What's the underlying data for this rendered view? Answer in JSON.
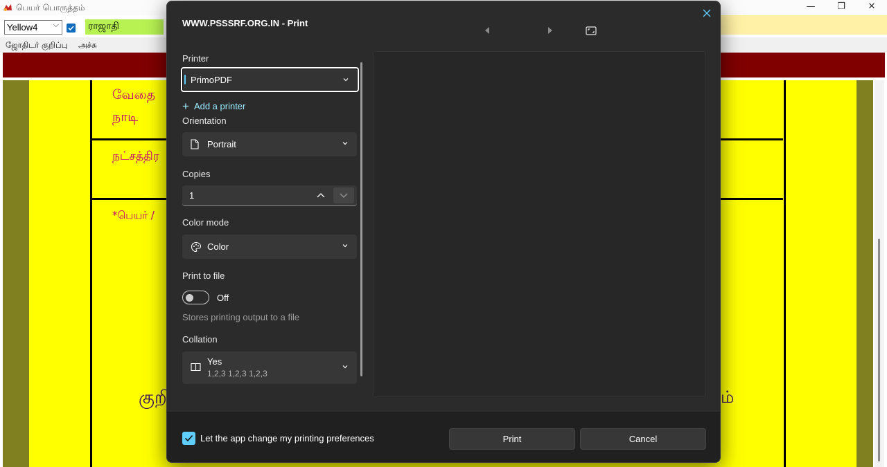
{
  "app": {
    "title": "பெயர் பொருத்தம்",
    "color_select_value": "Yellow4",
    "name_field_value": "ராஜாதி",
    "menu": [
      "ஜோதிடர் குறிப்பு",
      "அச்சு"
    ],
    "content_lines": [
      "வேதை",
      "நாடி",
      "நட்சத்திர",
      "*பெயர் /",
      "குறி",
      "ம்"
    ],
    "window_controls": [
      "minimize-icon",
      "restore-icon",
      "close-icon"
    ],
    "colors": {
      "maroon": "#800000",
      "yellow": "#ffff00",
      "olive": "#808020",
      "name_field": "#b7f252"
    }
  },
  "dialog": {
    "title": "WWW.PSSSRF.ORG.IN - Print",
    "printer": {
      "label": "Printer",
      "value": "PrimoPDF",
      "add_label": "Add a printer"
    },
    "orientation": {
      "label": "Orientation",
      "value": "Portrait"
    },
    "copies": {
      "label": "Copies",
      "value": "1"
    },
    "color_mode": {
      "label": "Color mode",
      "value": "Color"
    },
    "print_to_file": {
      "label": "Print to file",
      "state": "Off",
      "hint": "Stores printing output to a file"
    },
    "collation": {
      "label": "Collation",
      "value": "Yes",
      "detail": "1,2,3  1,2,3  1,2,3"
    },
    "preferences_label": "Let the app change my printing preferences",
    "print_button": "Print",
    "cancel_button": "Cancel",
    "colors": {
      "accent": "#60cdff",
      "background": "#2b2b2b",
      "footer": "#202020"
    }
  }
}
